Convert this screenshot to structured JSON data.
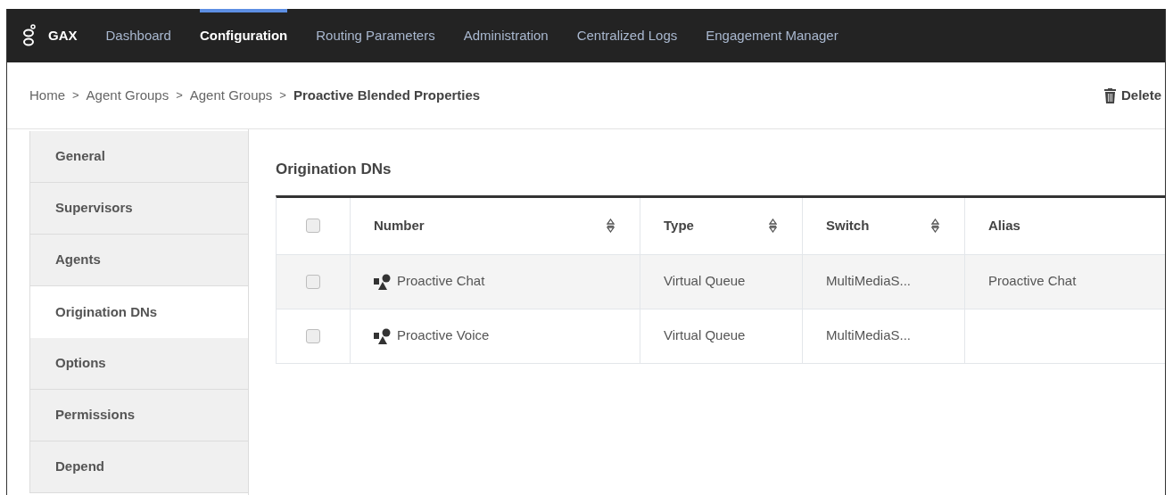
{
  "nav": {
    "brand": "GAX",
    "items": [
      {
        "label": "Dashboard",
        "selected": false
      },
      {
        "label": "Configuration",
        "selected": true
      },
      {
        "label": "Routing Parameters",
        "selected": false
      },
      {
        "label": "Administration",
        "selected": false
      },
      {
        "label": "Centralized Logs",
        "selected": false
      },
      {
        "label": "Engagement Manager",
        "selected": false
      }
    ]
  },
  "breadcrumb": [
    "Home",
    "Agent Groups",
    "Agent Groups",
    "Proactive Blended Properties"
  ],
  "separator": ">",
  "delete_button": "Delete",
  "sidebar": {
    "items": [
      {
        "label": "General",
        "selected": false
      },
      {
        "label": "Supervisors",
        "selected": false
      },
      {
        "label": "Agents",
        "selected": false
      },
      {
        "label": "Origination DNs",
        "selected": true
      },
      {
        "label": "Options",
        "selected": false
      },
      {
        "label": "Permissions",
        "selected": false
      },
      {
        "label": "Depend",
        "selected": false
      }
    ]
  },
  "section_title": "Origination DNs",
  "table": {
    "select_all_checked": false,
    "columns": [
      {
        "label": "Number",
        "sortable": true
      },
      {
        "label": "Type",
        "sortable": true
      },
      {
        "label": "Switch",
        "sortable": true
      },
      {
        "label": "Alias",
        "sortable": false
      }
    ],
    "rows": [
      {
        "checked": false,
        "cells": [
          "Proactive Chat",
          "Virtual Queue",
          "MultiMediaS...",
          "Proactive Chat"
        ]
      },
      {
        "checked": false,
        "cells": [
          "Proactive Voice",
          "Virtual Queue",
          "MultiMediaS...",
          ""
        ]
      }
    ]
  }
}
